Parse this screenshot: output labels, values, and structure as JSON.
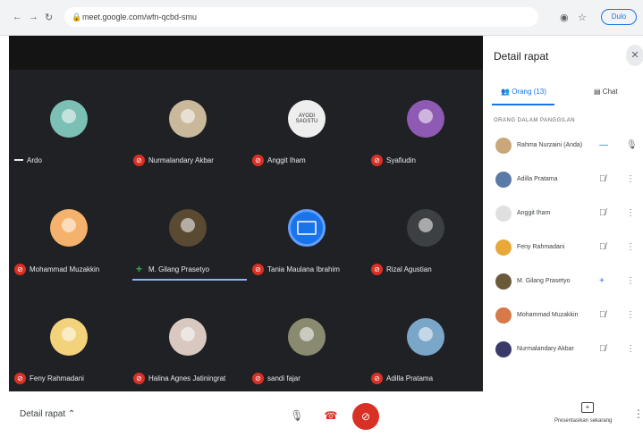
{
  "browser": {
    "url": "meet.google.com/wfn-qcbd-smu",
    "profile_label": "Dulo"
  },
  "meeting": {
    "tiles": [
      {
        "name": "Ardo",
        "status": "speaking",
        "avatar_color": "#7bbfb5"
      },
      {
        "name": "Nurmalandary Akbar",
        "status": "muted",
        "avatar_color": "#c9b89a"
      },
      {
        "name": "Anggit Iham",
        "status": "muted",
        "avatar_color": "#eeeeee",
        "avatar_text": "AYODI SAGSTU"
      },
      {
        "name": "Syafiudin",
        "status": "muted",
        "avatar_color": "#8e5ab3"
      },
      {
        "name": "Mohammad Muzakkin",
        "status": "muted",
        "avatar_color": "#f4b26c"
      },
      {
        "name": "M. Gilang Prasetyo",
        "status": "active",
        "avatar_color": "#5a4a32"
      },
      {
        "name": "Tania Maulana Ibrahim",
        "status": "muted",
        "avatar_color": "#1a73e8",
        "avatar_type": "mail"
      },
      {
        "name": "Rizal Agustian",
        "status": "muted",
        "avatar_color": "#3c4043"
      },
      {
        "name": "Feny Rahmadani",
        "status": "muted",
        "avatar_color": "#f2d27a"
      },
      {
        "name": "Halina Agnes Jatiningrat",
        "status": "muted",
        "avatar_color": "#d8c8c0"
      },
      {
        "name": "sandi fajar",
        "status": "muted",
        "avatar_color": "#8a8a70"
      },
      {
        "name": "Adilla Pratama",
        "status": "muted",
        "avatar_color": "#7aa6c8"
      }
    ]
  },
  "panel": {
    "title": "Detail rapat",
    "tabs": [
      {
        "label": "Orang (13)",
        "icon": "people-icon",
        "active": true
      },
      {
        "label": "Chat",
        "icon": "chat-icon",
        "active": false
      }
    ],
    "section_header": "ORANG DALAM PANGGILAN",
    "people": [
      {
        "name": "Rahma Nurzaini (Anda)",
        "mic": "on-dash",
        "avatar_color": "#c9a77a"
      },
      {
        "name": "Adilla Pratama",
        "mic": "muted",
        "avatar_color": "#5a7aa8"
      },
      {
        "name": "Anggit Iham",
        "mic": "muted",
        "avatar_color": "#e0e0e0"
      },
      {
        "name": "Feny Rahmadani",
        "mic": "muted",
        "avatar_color": "#e6a93a"
      },
      {
        "name": "M. Gilang Prasetyo",
        "mic": "active",
        "avatar_color": "#6b5a3a"
      },
      {
        "name": "Mohammad Muzakkin",
        "mic": "muted",
        "avatar_color": "#d77a4a"
      },
      {
        "name": "Nurmalandary Akbar",
        "mic": "muted",
        "avatar_color": "#3a3a6a"
      }
    ]
  },
  "bottom_bar": {
    "meeting_details_label": "Detail rapat",
    "present_label": "Presentasikan sekarang"
  },
  "colors": {
    "accent": "#1a73e8",
    "danger": "#d93025",
    "stage_bg": "#202124"
  }
}
